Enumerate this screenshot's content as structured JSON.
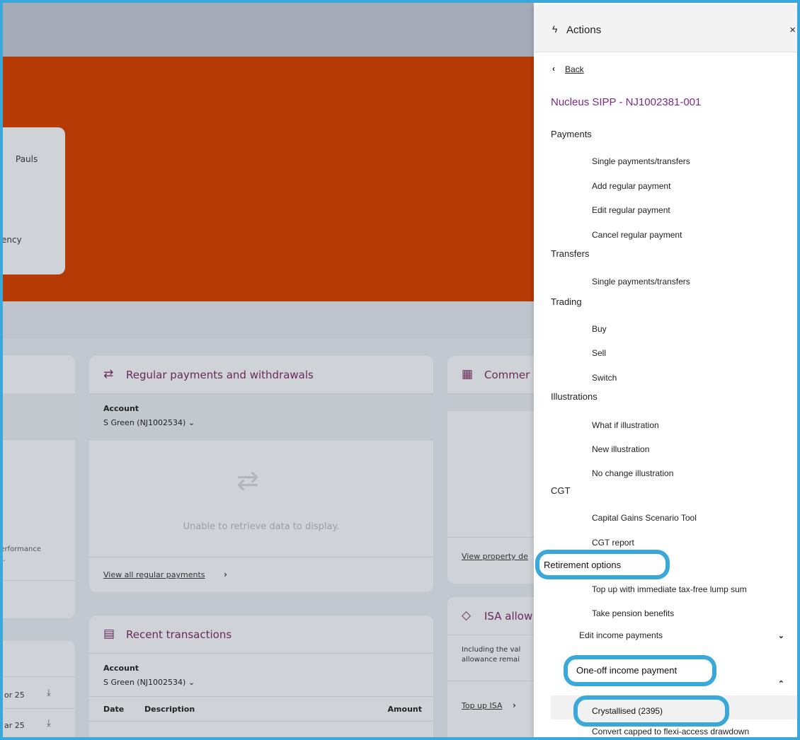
{
  "background": {
    "hero_text_1": "Pauls",
    "hero_text_2": "ency",
    "left_card_text": "performance\nrn.",
    "regular_card": {
      "title": "Regular payments and withdrawals",
      "account_label": "Account",
      "account_value": "S Green (NJ1002534) ⌄",
      "empty_text": "Unable to retrieve data to display.",
      "link": "View all regular payments"
    },
    "transactions_card": {
      "title": "Recent transactions",
      "account_label": "Account",
      "account_value": "S Green (NJ1002534) ⌄",
      "col_date": "Date",
      "col_description": "Description",
      "col_amount": "Amount"
    },
    "commercial_card": {
      "title": "Commer",
      "link": "View property de"
    },
    "isa_card": {
      "title": "ISA allow",
      "text": "Including the val\nallowance remai",
      "link": "Top up ISA"
    },
    "left_rows": [
      {
        "date": "or 25"
      },
      {
        "date": "ar 25"
      }
    ]
  },
  "panel": {
    "title": "Actions",
    "close": "×",
    "back": "Back",
    "account": "Nucleus SIPP - NJ1002381-001",
    "sections": {
      "payments": "Payments",
      "transfers": "Transfers",
      "trading": "Trading",
      "illustrations": "Illustrations",
      "cgt": "CGT",
      "retirement": "Retirement options"
    },
    "items": {
      "single_payments": "Single payments/transfers",
      "add_regular": "Add regular payment",
      "edit_regular": "Edit regular payment",
      "cancel_regular": "Cancel regular payment",
      "transfers_single": "Single payments/transfers",
      "buy": "Buy",
      "sell": "Sell",
      "switch": "Switch",
      "what_if": "What if illustration",
      "new_illustration": "New illustration",
      "no_change": "No change illustration",
      "cgt_tool": "Capital Gains Scenario Tool",
      "cgt_report": "CGT report",
      "top_up": "Top up with immediate tax-free lump sum",
      "take_benefits": "Take pension benefits",
      "edit_income": "Edit income payments",
      "one_off": "One-off income payment",
      "crystallised": "Crystallised (2395)",
      "convert": "Convert capped to flexi-access drawdown"
    }
  }
}
